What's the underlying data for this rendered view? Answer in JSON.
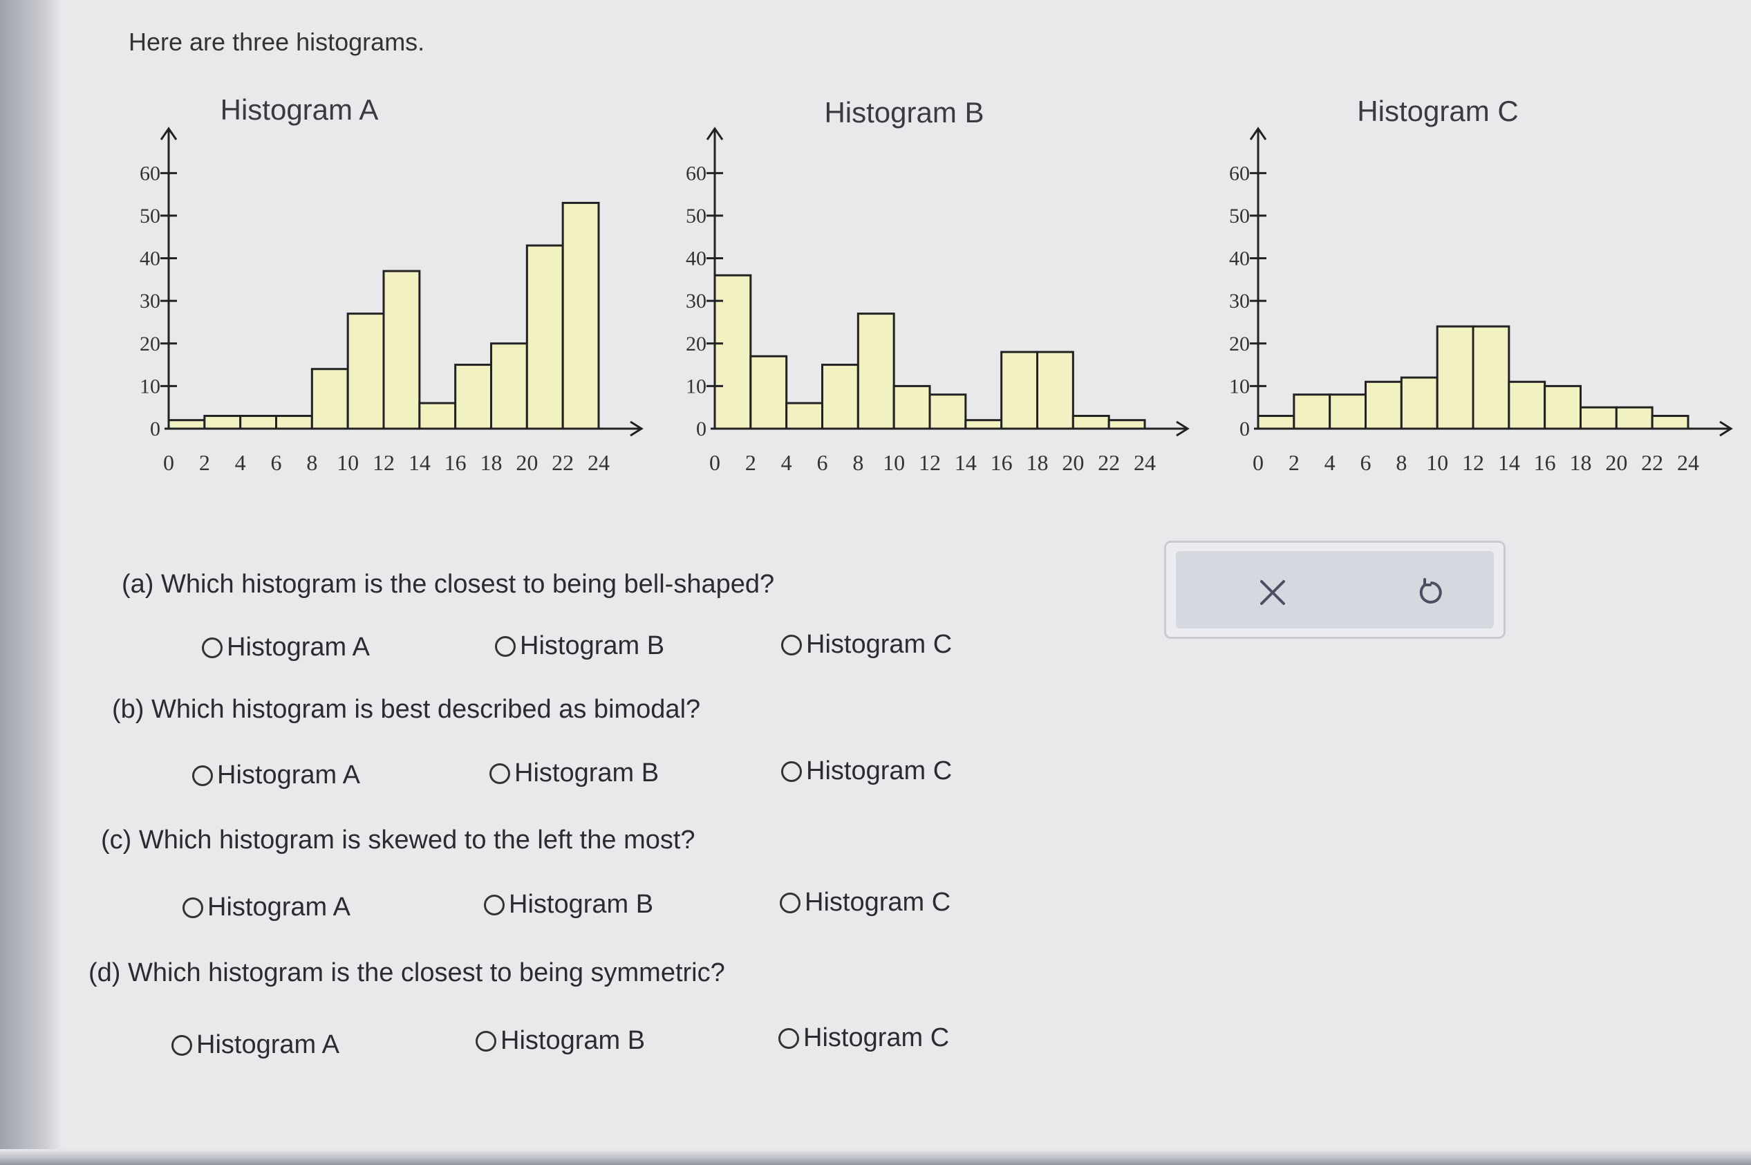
{
  "intro_text": "Here are three histograms.",
  "chart_data": [
    {
      "type": "bar",
      "title": "Histogram A",
      "bin_edges": [
        0,
        2,
        4,
        6,
        8,
        10,
        12,
        14,
        16,
        18,
        20,
        22,
        24
      ],
      "x_ticks": [
        0,
        2,
        4,
        6,
        8,
        10,
        12,
        14,
        16,
        18,
        20,
        22,
        24
      ],
      "y_ticks": [
        0,
        10,
        20,
        30,
        40,
        50,
        60
      ],
      "values": [
        2,
        3,
        3,
        3,
        14,
        27,
        37,
        6,
        15,
        20,
        43,
        53
      ],
      "ylim": [
        0,
        62
      ],
      "xlabel": "",
      "ylabel": ""
    },
    {
      "type": "bar",
      "title": "Histogram B",
      "bin_edges": [
        0,
        2,
        4,
        6,
        8,
        10,
        12,
        14,
        16,
        18,
        20,
        22,
        24
      ],
      "x_ticks": [
        0,
        2,
        4,
        6,
        8,
        10,
        12,
        14,
        16,
        18,
        20,
        22,
        24
      ],
      "y_ticks": [
        0,
        10,
        20,
        30,
        40,
        50,
        60
      ],
      "values": [
        36,
        17,
        6,
        15,
        27,
        10,
        8,
        2,
        18,
        18,
        3,
        2
      ],
      "ylim": [
        0,
        62
      ],
      "xlabel": "",
      "ylabel": ""
    },
    {
      "type": "bar",
      "title": "Histogram C",
      "bin_edges": [
        0,
        2,
        4,
        6,
        8,
        10,
        12,
        14,
        16,
        18,
        20,
        22,
        24
      ],
      "x_ticks": [
        0,
        2,
        4,
        6,
        8,
        10,
        12,
        14,
        16,
        18,
        20,
        22,
        24
      ],
      "y_ticks": [
        0,
        10,
        20,
        30,
        40,
        50,
        60
      ],
      "values": [
        3,
        8,
        8,
        11,
        12,
        24,
        24,
        11,
        10,
        5,
        5,
        3
      ],
      "ylim": [
        0,
        62
      ],
      "xlabel": "",
      "ylabel": ""
    }
  ],
  "questions": [
    {
      "label": "(a) Which histogram is the closest to being bell-shaped?",
      "options": [
        "Histogram A",
        "Histogram B",
        "Histogram C"
      ]
    },
    {
      "label": "(b) Which histogram is best described as bimodal?",
      "options": [
        "Histogram A",
        "Histogram B",
        "Histogram C"
      ]
    },
    {
      "label": "(c) Which histogram is skewed to the left the most?",
      "options": [
        "Histogram A",
        "Histogram B",
        "Histogram C"
      ]
    },
    {
      "label": "(d) Which histogram is the closest to being symmetric?",
      "options": [
        "Histogram A",
        "Histogram B",
        "Histogram C"
      ]
    }
  ],
  "tools": {
    "clear_icon": "x-icon",
    "undo_icon": "undo-icon",
    "clear_glyph": "✕",
    "undo_glyph": "↺"
  },
  "colors": {
    "bar_fill": "#f2f1c2",
    "bar_stroke": "#222222",
    "background": "#e9e9ec"
  }
}
